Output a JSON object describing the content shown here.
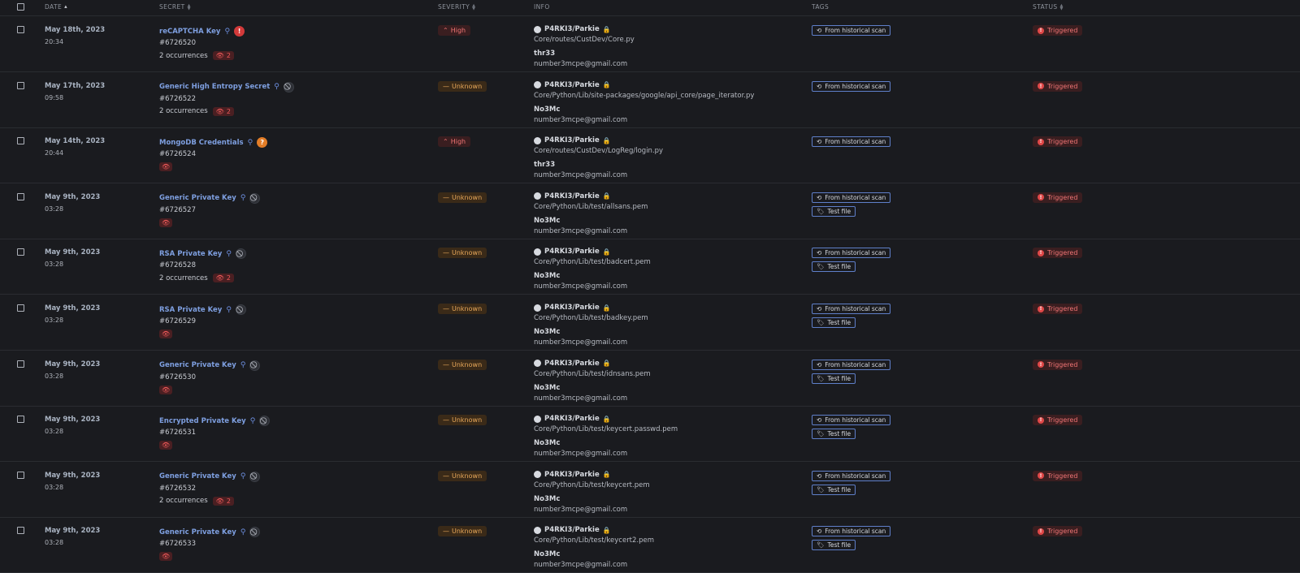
{
  "header": {
    "date": "DATE",
    "secret": "SECRET",
    "severity": "SEVERITY",
    "info": "INFO",
    "tags": "TAGS",
    "status": "STATUS"
  },
  "rows": [
    {
      "date": "May 18th, 2023",
      "time": "20:34",
      "name": "reCAPTCHA Key",
      "status_icon": "red",
      "id": "#6726520",
      "occurrences": "2 occurrences",
      "eye_count": "2",
      "severity": "High",
      "repo": "P4RKI3/Parkie",
      "path": "Core/routes/CustDev/Core.py",
      "author": "thr33",
      "email": "number3mcpe@gmail.com",
      "tag1": "From historical scan",
      "tag2": "",
      "status": "Triggered"
    },
    {
      "date": "May 17th, 2023",
      "time": "09:58",
      "name": "Generic High Entropy Secret",
      "status_icon": "gray",
      "id": "#6726522",
      "occurrences": "2 occurrences",
      "eye_count": "2",
      "severity": "Unknown",
      "repo": "P4RKI3/Parkie",
      "path": "Core/Python/Lib/site-packages/google/api_core/page_iterator.py",
      "author": "No3Mc",
      "email": "number3mcpe@gmail.com",
      "tag1": "From historical scan",
      "tag2": "",
      "status": "Triggered"
    },
    {
      "date": "May 14th, 2023",
      "time": "20:44",
      "name": "MongoDB Credentials",
      "status_icon": "orange",
      "id": "#6726524",
      "occurrences": "",
      "eye_count": "",
      "severity": "High",
      "repo": "P4RKI3/Parkie",
      "path": "Core/routes/CustDev/LogReg/login.py",
      "author": "thr33",
      "email": "number3mcpe@gmail.com",
      "tag1": "From historical scan",
      "tag2": "",
      "status": "Triggered"
    },
    {
      "date": "May 9th, 2023",
      "time": "03:28",
      "name": "Generic Private Key",
      "status_icon": "gray",
      "id": "#6726527",
      "occurrences": "",
      "eye_count": "",
      "severity": "Unknown",
      "repo": "P4RKI3/Parkie",
      "path": "Core/Python/Lib/test/allsans.pem",
      "author": "No3Mc",
      "email": "number3mcpe@gmail.com",
      "tag1": "From historical scan",
      "tag2": "Test file",
      "status": "Triggered"
    },
    {
      "date": "May 9th, 2023",
      "time": "03:28",
      "name": "RSA Private Key",
      "status_icon": "gray",
      "id": "#6726528",
      "occurrences": "2 occurrences",
      "eye_count": "2",
      "severity": "Unknown",
      "repo": "P4RKI3/Parkie",
      "path": "Core/Python/Lib/test/badcert.pem",
      "author": "No3Mc",
      "email": "number3mcpe@gmail.com",
      "tag1": "From historical scan",
      "tag2": "Test file",
      "status": "Triggered"
    },
    {
      "date": "May 9th, 2023",
      "time": "03:28",
      "name": "RSA Private Key",
      "status_icon": "gray",
      "id": "#6726529",
      "occurrences": "",
      "eye_count": "",
      "severity": "Unknown",
      "repo": "P4RKI3/Parkie",
      "path": "Core/Python/Lib/test/badkey.pem",
      "author": "No3Mc",
      "email": "number3mcpe@gmail.com",
      "tag1": "From historical scan",
      "tag2": "Test file",
      "status": "Triggered"
    },
    {
      "date": "May 9th, 2023",
      "time": "03:28",
      "name": "Generic Private Key",
      "status_icon": "gray",
      "id": "#6726530",
      "occurrences": "",
      "eye_count": "",
      "severity": "Unknown",
      "repo": "P4RKI3/Parkie",
      "path": "Core/Python/Lib/test/idnsans.pem",
      "author": "No3Mc",
      "email": "number3mcpe@gmail.com",
      "tag1": "From historical scan",
      "tag2": "Test file",
      "status": "Triggered"
    },
    {
      "date": "May 9th, 2023",
      "time": "03:28",
      "name": "Encrypted Private Key",
      "status_icon": "gray",
      "id": "#6726531",
      "occurrences": "",
      "eye_count": "",
      "severity": "Unknown",
      "repo": "P4RKI3/Parkie",
      "path": "Core/Python/Lib/test/keycert.passwd.pem",
      "author": "No3Mc",
      "email": "number3mcpe@gmail.com",
      "tag1": "From historical scan",
      "tag2": "Test file",
      "status": "Triggered"
    },
    {
      "date": "May 9th, 2023",
      "time": "03:28",
      "name": "Generic Private Key",
      "status_icon": "gray",
      "id": "#6726532",
      "occurrences": "2 occurrences",
      "eye_count": "2",
      "severity": "Unknown",
      "repo": "P4RKI3/Parkie",
      "path": "Core/Python/Lib/test/keycert.pem",
      "author": "No3Mc",
      "email": "number3mcpe@gmail.com",
      "tag1": "From historical scan",
      "tag2": "Test file",
      "status": "Triggered"
    },
    {
      "date": "May 9th, 2023",
      "time": "03:28",
      "name": "Generic Private Key",
      "status_icon": "gray",
      "id": "#6726533",
      "occurrences": "",
      "eye_count": "",
      "severity": "Unknown",
      "repo": "P4RKI3/Parkie",
      "path": "Core/Python/Lib/test/keycert2.pem",
      "author": "No3Mc",
      "email": "number3mcpe@gmail.com",
      "tag1": "From historical scan",
      "tag2": "Test file",
      "status": "Triggered"
    }
  ]
}
